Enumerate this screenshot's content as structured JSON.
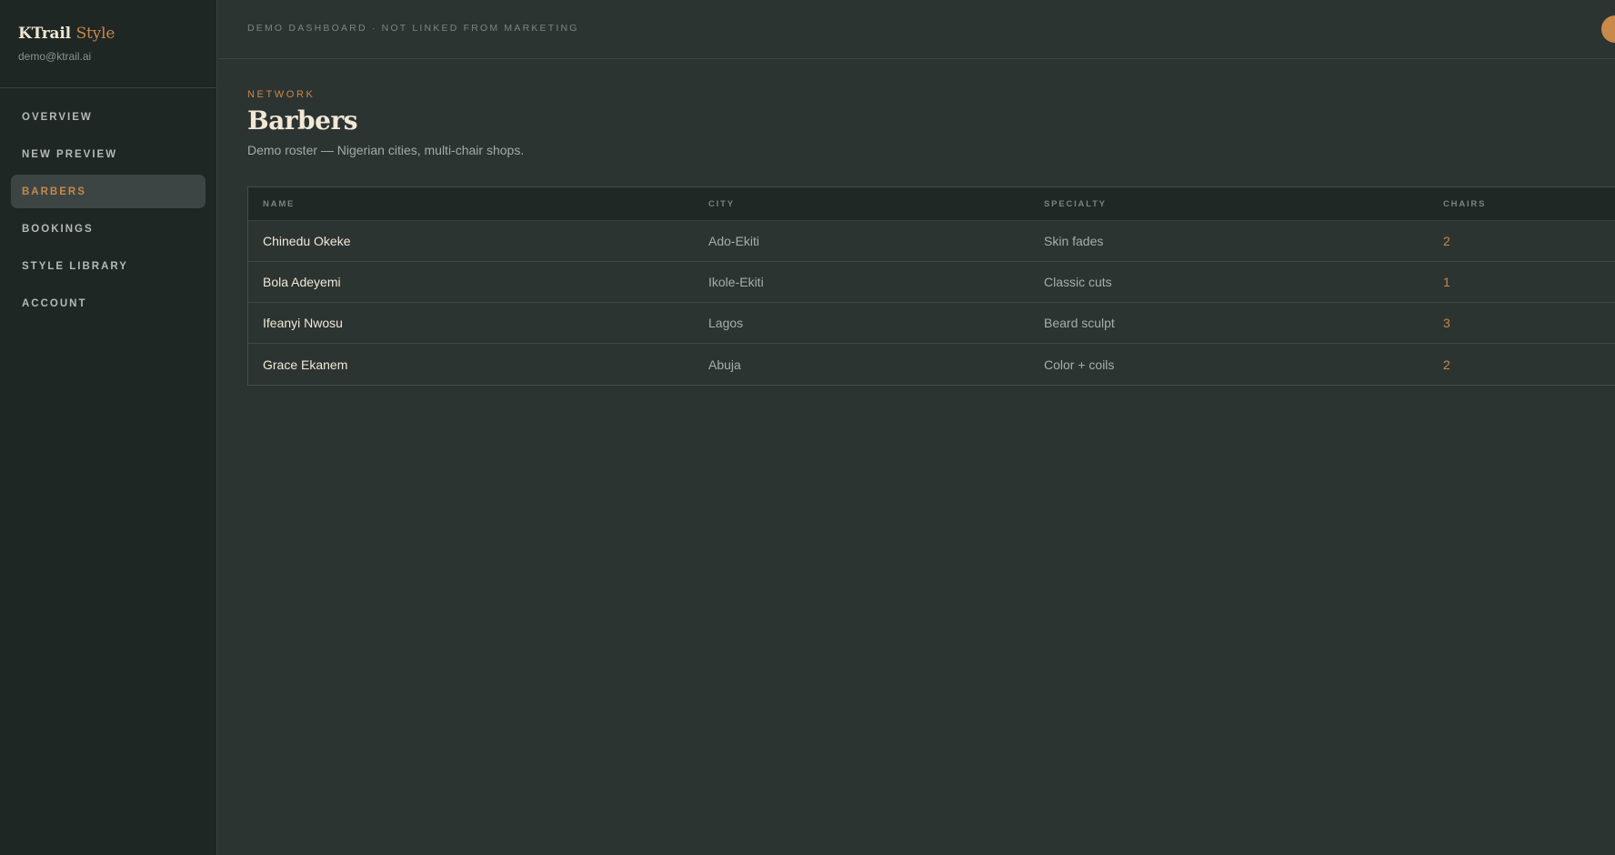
{
  "sidebar": {
    "brand": {
      "name": "KTrail",
      "accent": "Style"
    },
    "email": "demo@ktrail.ai",
    "items": [
      {
        "label": "OVERVIEW",
        "active": false
      },
      {
        "label": "NEW PREVIEW",
        "active": false
      },
      {
        "label": "BARBERS",
        "active": true
      },
      {
        "label": "BOOKINGS",
        "active": false
      },
      {
        "label": "STYLE LIBRARY",
        "active": false
      },
      {
        "label": "ACCOUNT",
        "active": false
      }
    ]
  },
  "topbar": {
    "text": "DEMO DASHBOARD · NOT LINKED FROM MARKETING"
  },
  "page": {
    "eyebrow": "NETWORK",
    "title": "Barbers",
    "subtitle": "Demo roster — Nigerian cities, multi-chair shops."
  },
  "table": {
    "columns": [
      "NAME",
      "CITY",
      "SPECIALTY",
      "CHAIRS"
    ],
    "rows": [
      {
        "name": "Chinedu Okeke",
        "city": "Ado-Ekiti",
        "specialty": "Skin fades",
        "chairs": "2"
      },
      {
        "name": "Bola Adeyemi",
        "city": "Ikole-Ekiti",
        "specialty": "Classic cuts",
        "chairs": "1"
      },
      {
        "name": "Ifeanyi Nwosu",
        "city": "Lagos",
        "specialty": "Beard sculpt",
        "chairs": "3"
      },
      {
        "name": "Grace Ekanem",
        "city": "Abuja",
        "specialty": "Color + coils",
        "chairs": "2"
      }
    ]
  },
  "colors": {
    "accent": "#c8874a",
    "background": "#2c3432",
    "sidebar": "#1f2725",
    "text": "#f1e8d6"
  }
}
